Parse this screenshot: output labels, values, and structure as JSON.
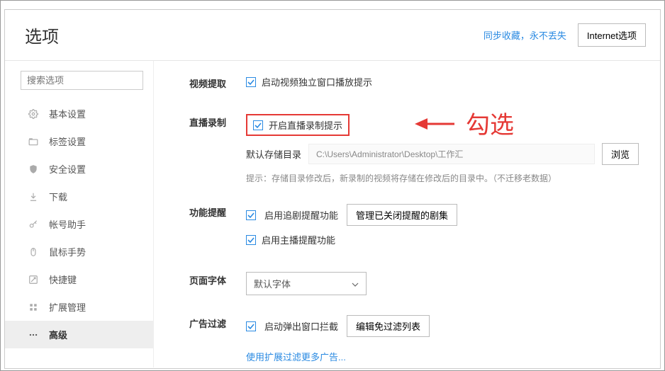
{
  "header": {
    "title": "选项",
    "sync_link": "同步收藏，永不丢失",
    "ie_button": "Internet选项"
  },
  "sidebar": {
    "search_placeholder": "搜索选项",
    "items": [
      {
        "icon": "gear",
        "label": "基本设置"
      },
      {
        "icon": "tab",
        "label": "标签设置"
      },
      {
        "icon": "shield",
        "label": "安全设置"
      },
      {
        "icon": "download",
        "label": "下载"
      },
      {
        "icon": "key",
        "label": "帐号助手"
      },
      {
        "icon": "mouse",
        "label": "鼠标手势"
      },
      {
        "icon": "shortcut",
        "label": "快捷键"
      },
      {
        "icon": "extension",
        "label": "扩展管理"
      },
      {
        "icon": "dots",
        "label": "高级"
      }
    ]
  },
  "sections": {
    "video_extract": {
      "label": "视频提取",
      "cb1": "启动视频独立窗口播放提示"
    },
    "live_record": {
      "label": "直播录制",
      "cb1": "开启直播录制提示",
      "dir_label": "默认存储目录",
      "dir_value": "C:\\Users\\Administrator\\Desktop\\工作汇",
      "browse": "浏览",
      "hint": "提示：存储目录修改后，新录制的视频将存储在修改后的目录中。（不迁移老数据）"
    },
    "reminder": {
      "label": "功能提醒",
      "cb1": "启用追剧提醒功能",
      "manage": "管理已关闭提醒的剧集",
      "cb2": "启用主播提醒功能"
    },
    "font": {
      "label": "页面字体",
      "value": "默认字体"
    },
    "adblock": {
      "label": "广告过滤",
      "cb1": "启动弹出窗口拦截",
      "edit": "编辑免过滤列表",
      "more": "使用扩展过滤更多广告..."
    }
  },
  "annotation": {
    "text": "勾选"
  }
}
